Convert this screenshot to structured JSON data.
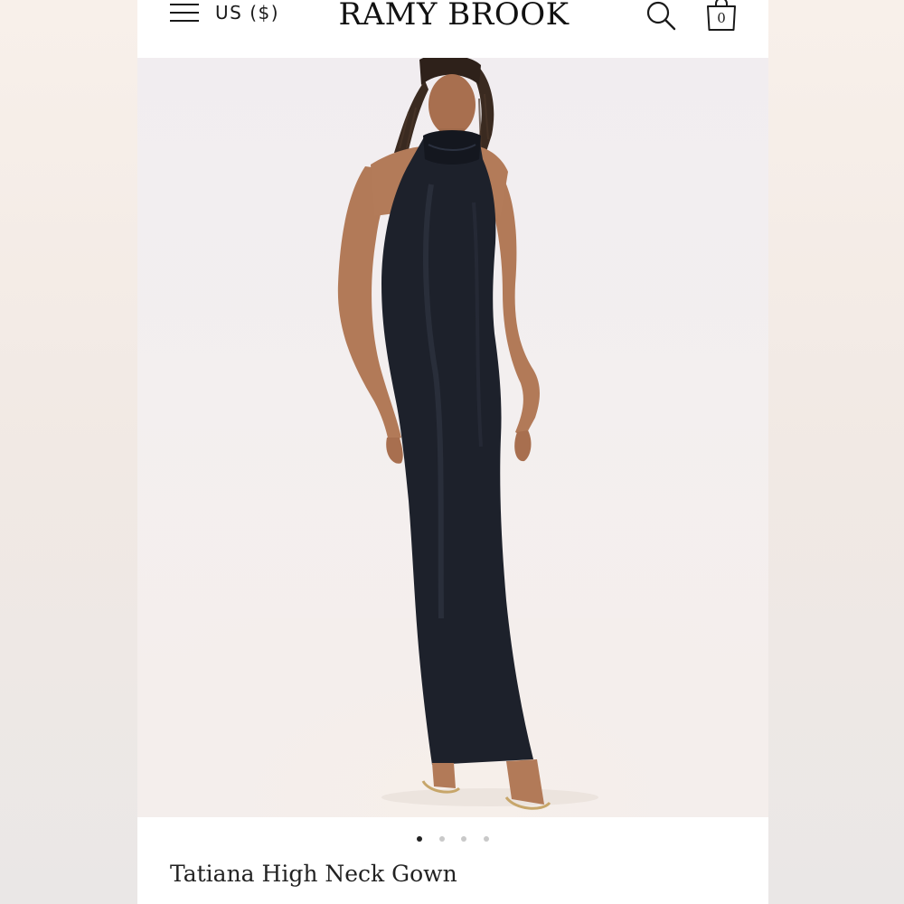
{
  "header": {
    "currency": "US ($)",
    "brand": "RAMY BROOK",
    "cart_count": "0",
    "menu_icon": "hamburger-menu-icon",
    "search_icon": "search-icon",
    "bag_icon": "shopping-bag-icon"
  },
  "gallery": {
    "total_images": 4,
    "active_index": 0
  },
  "product": {
    "name": "Tatiana High Neck Gown"
  },
  "colors": {
    "accent": "#111111",
    "dress": "#1d212b",
    "inactive_dot": "#c9c9c9"
  }
}
